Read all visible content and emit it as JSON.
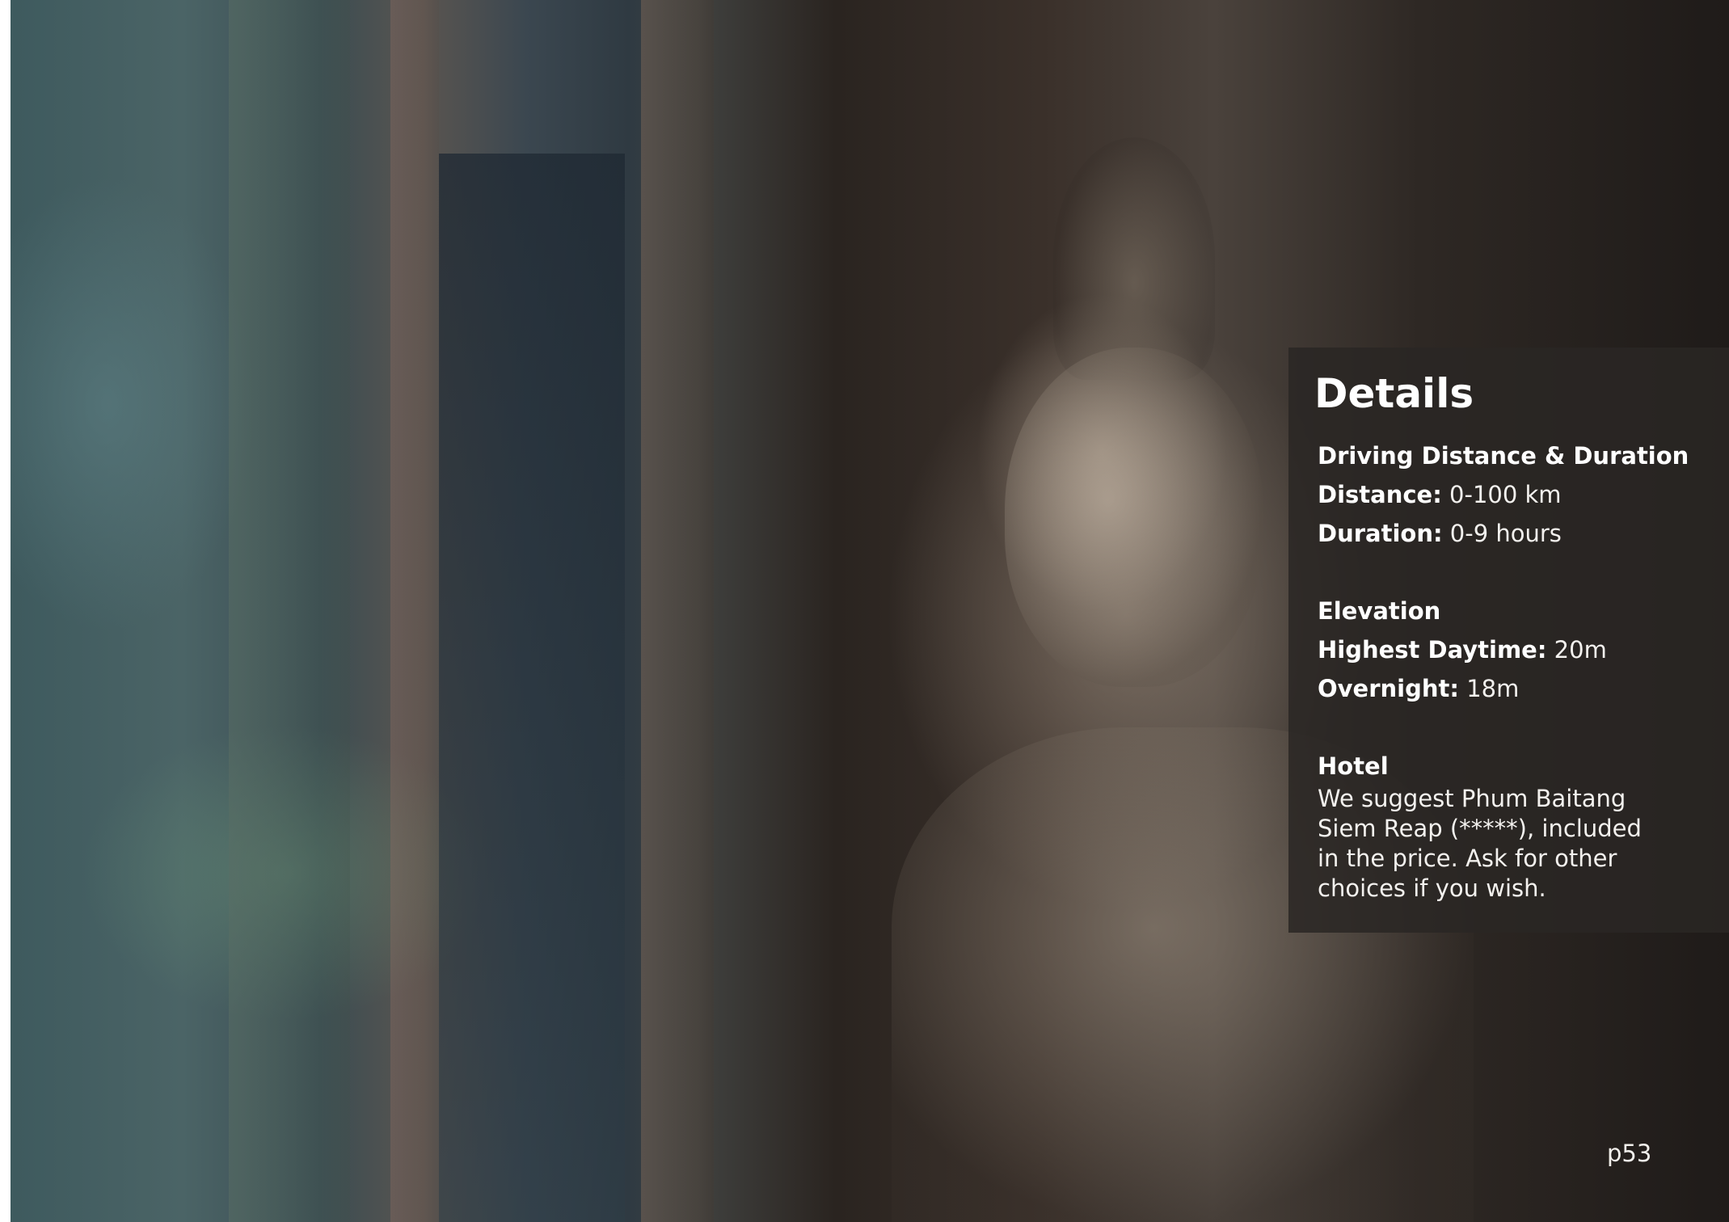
{
  "details": {
    "title": "Details",
    "driving": {
      "heading": "Driving Distance & Duration",
      "distance_label": "Distance:",
      "distance_value": "0-100 km",
      "duration_label": "Duration:",
      "duration_value": "0-9 hours"
    },
    "elevation": {
      "heading": "Elevation",
      "highest_label": "Highest Daytime:",
      "highest_value": "20m",
      "overnight_label": "Overnight:",
      "overnight_value": "18m"
    },
    "hotel": {
      "heading": "Hotel",
      "text": "We suggest Phum Baitang Siem Reap (*****), included in the price. Ask for other choices if you wish."
    }
  },
  "page_number": "p53"
}
